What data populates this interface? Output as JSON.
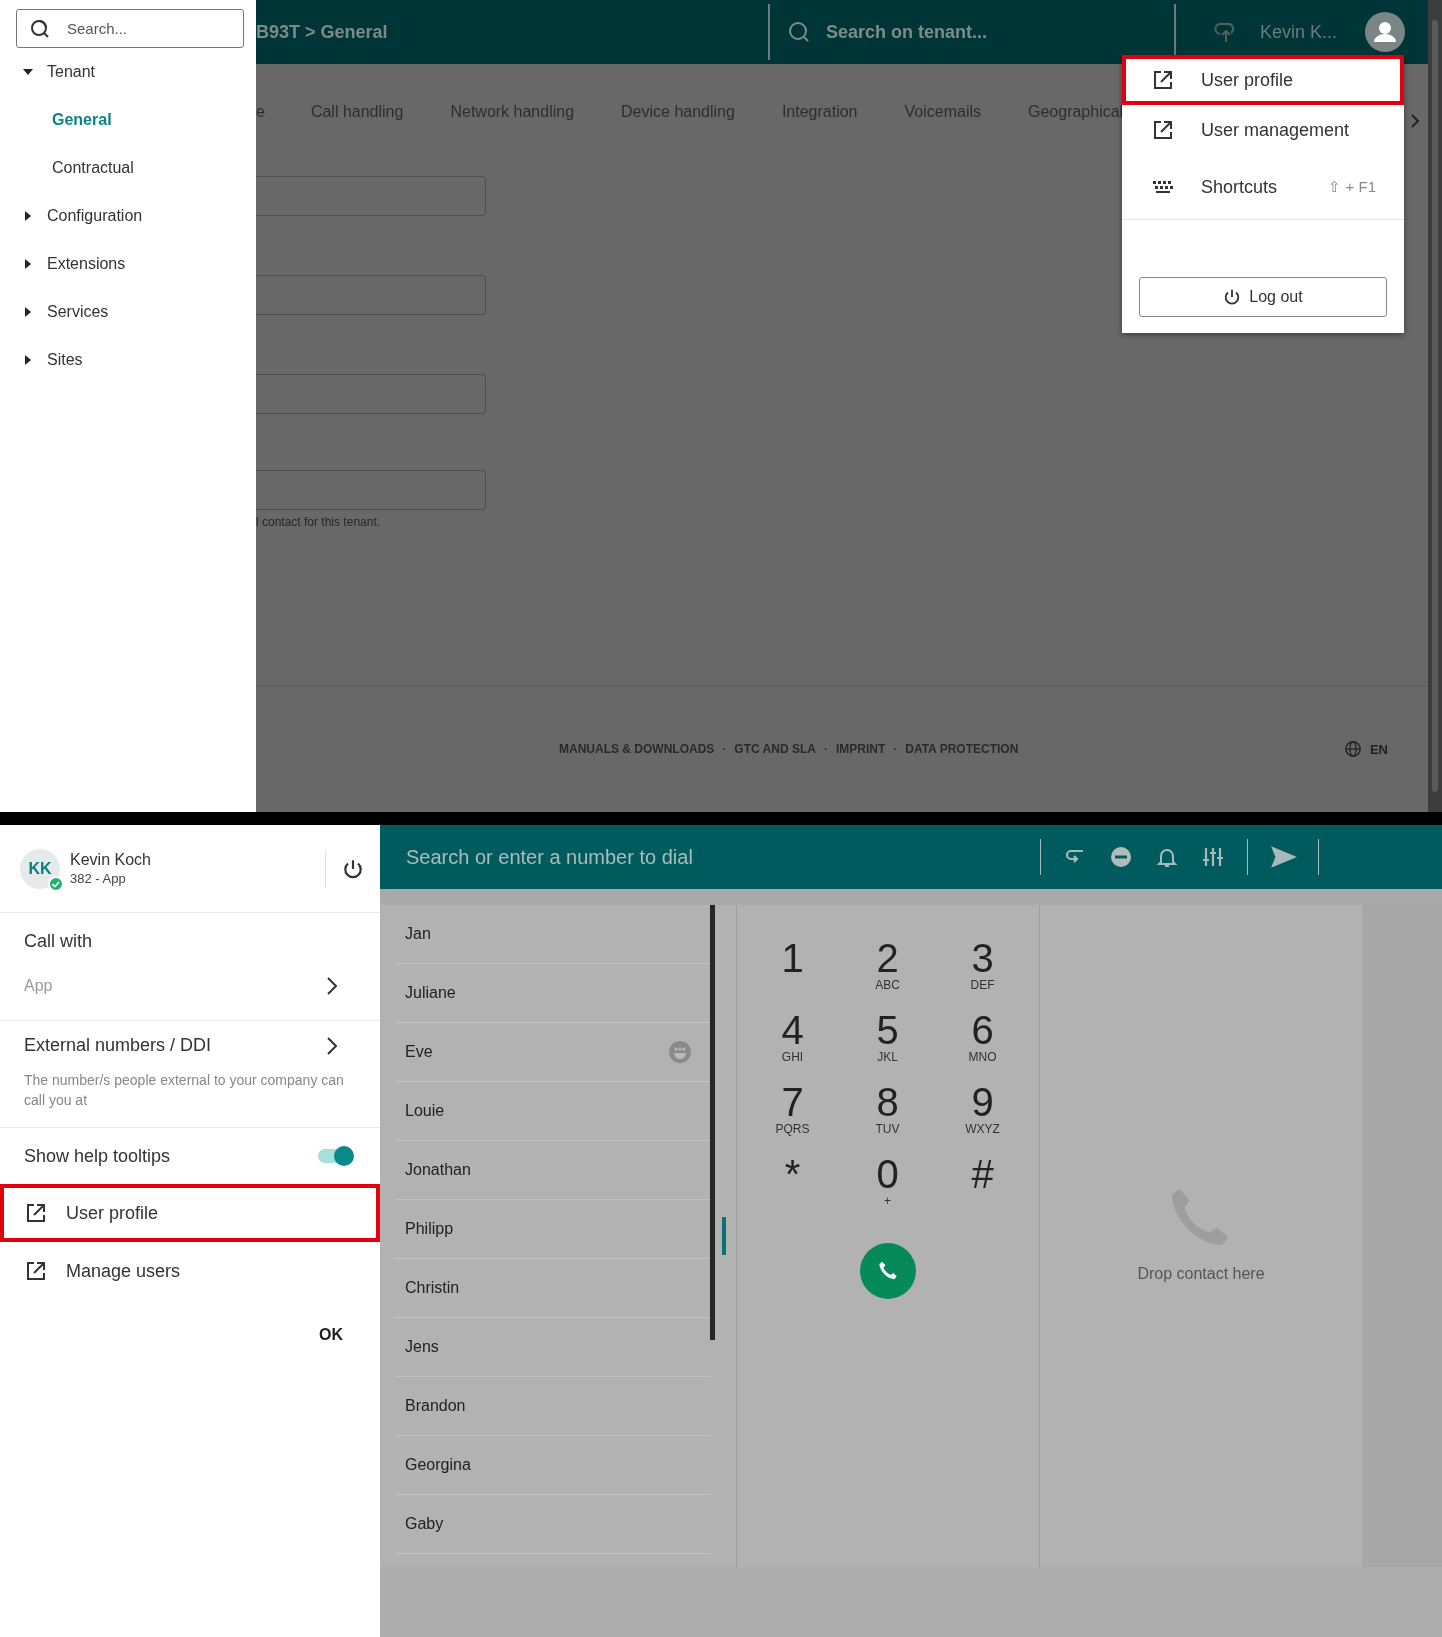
{
  "admin": {
    "sidebar": {
      "search": {
        "placeholder": "Search..."
      },
      "tree": [
        {
          "label": "Tenant",
          "expanded": true,
          "children": [
            {
              "label": "General",
              "selected": true
            },
            {
              "label": "Contractual",
              "selected": false
            }
          ]
        },
        {
          "label": "Configuration",
          "expanded": false
        },
        {
          "label": "Extensions",
          "expanded": false
        },
        {
          "label": "Services",
          "expanded": false
        },
        {
          "label": "Sites",
          "expanded": false
        }
      ]
    },
    "breadcrumb": "B93T > General",
    "tenant_search": {
      "placeholder": "Search on tenant..."
    },
    "user_name": "Kevin K...",
    "tabs": [
      "e",
      "Call handling",
      "Network handling",
      "Device handling",
      "Integration",
      "Voicemails",
      "Geographical"
    ],
    "helper_text": "l contact for this tenant.",
    "footer_links": [
      "MANUALS & DOWNLOADS",
      "GTC AND SLA",
      "IMPRINT",
      "DATA PROTECTION"
    ],
    "footer_separator": "·",
    "language": "EN",
    "user_menu": {
      "items": [
        {
          "kind": "link",
          "label": "User profile",
          "highlighted": true
        },
        {
          "kind": "link",
          "label": "User management",
          "highlighted": false
        },
        {
          "kind": "shortcut",
          "label": "Shortcuts",
          "shortcut": "⇧ + F1",
          "highlighted": false
        }
      ],
      "logout": "Log out"
    }
  },
  "phone": {
    "profile": {
      "initials": "KK",
      "name": "Kevin Koch",
      "extension": "382 - App",
      "online": true
    },
    "call_with": {
      "title": "Call with",
      "value": "App"
    },
    "external": {
      "title": "External numbers / DDI",
      "description": "The number/s people external to your company can call you at"
    },
    "tooltips": {
      "label": "Show help tooltips",
      "on": true
    },
    "links": [
      {
        "label": "User profile",
        "highlighted": true
      },
      {
        "label": "Manage users",
        "highlighted": false
      }
    ],
    "ok": "OK",
    "dial_search": {
      "placeholder": "Search or enter a number to dial"
    },
    "contacts": [
      {
        "name": "Jan",
        "has_icon": false
      },
      {
        "name": "Juliane",
        "has_icon": false
      },
      {
        "name": "Eve",
        "has_icon": true
      },
      {
        "name": "Louie",
        "has_icon": false
      },
      {
        "name": "Jonathan",
        "has_icon": false
      },
      {
        "name": "Philipp",
        "has_icon": false
      },
      {
        "name": "Christin",
        "has_icon": false
      },
      {
        "name": "Jens",
        "has_icon": false
      },
      {
        "name": "Brandon",
        "has_icon": false
      },
      {
        "name": "Georgina",
        "has_icon": false
      },
      {
        "name": "Gaby",
        "has_icon": false
      }
    ],
    "keypad": [
      {
        "digit": "1"
      },
      {
        "digit": "2",
        "letters": "ABC"
      },
      {
        "digit": "3",
        "letters": "DEF"
      },
      {
        "digit": "4",
        "letters": "GHI"
      },
      {
        "digit": "5",
        "letters": "JKL"
      },
      {
        "digit": "6",
        "letters": "MNO"
      },
      {
        "digit": "7",
        "letters": "PQRS"
      },
      {
        "digit": "8",
        "letters": "TUV"
      },
      {
        "digit": "9",
        "letters": "WXYZ"
      },
      {
        "digit": "*"
      },
      {
        "digit": "0",
        "letters": "+"
      },
      {
        "digit": "#"
      }
    ],
    "drop_text": "Drop contact here"
  }
}
